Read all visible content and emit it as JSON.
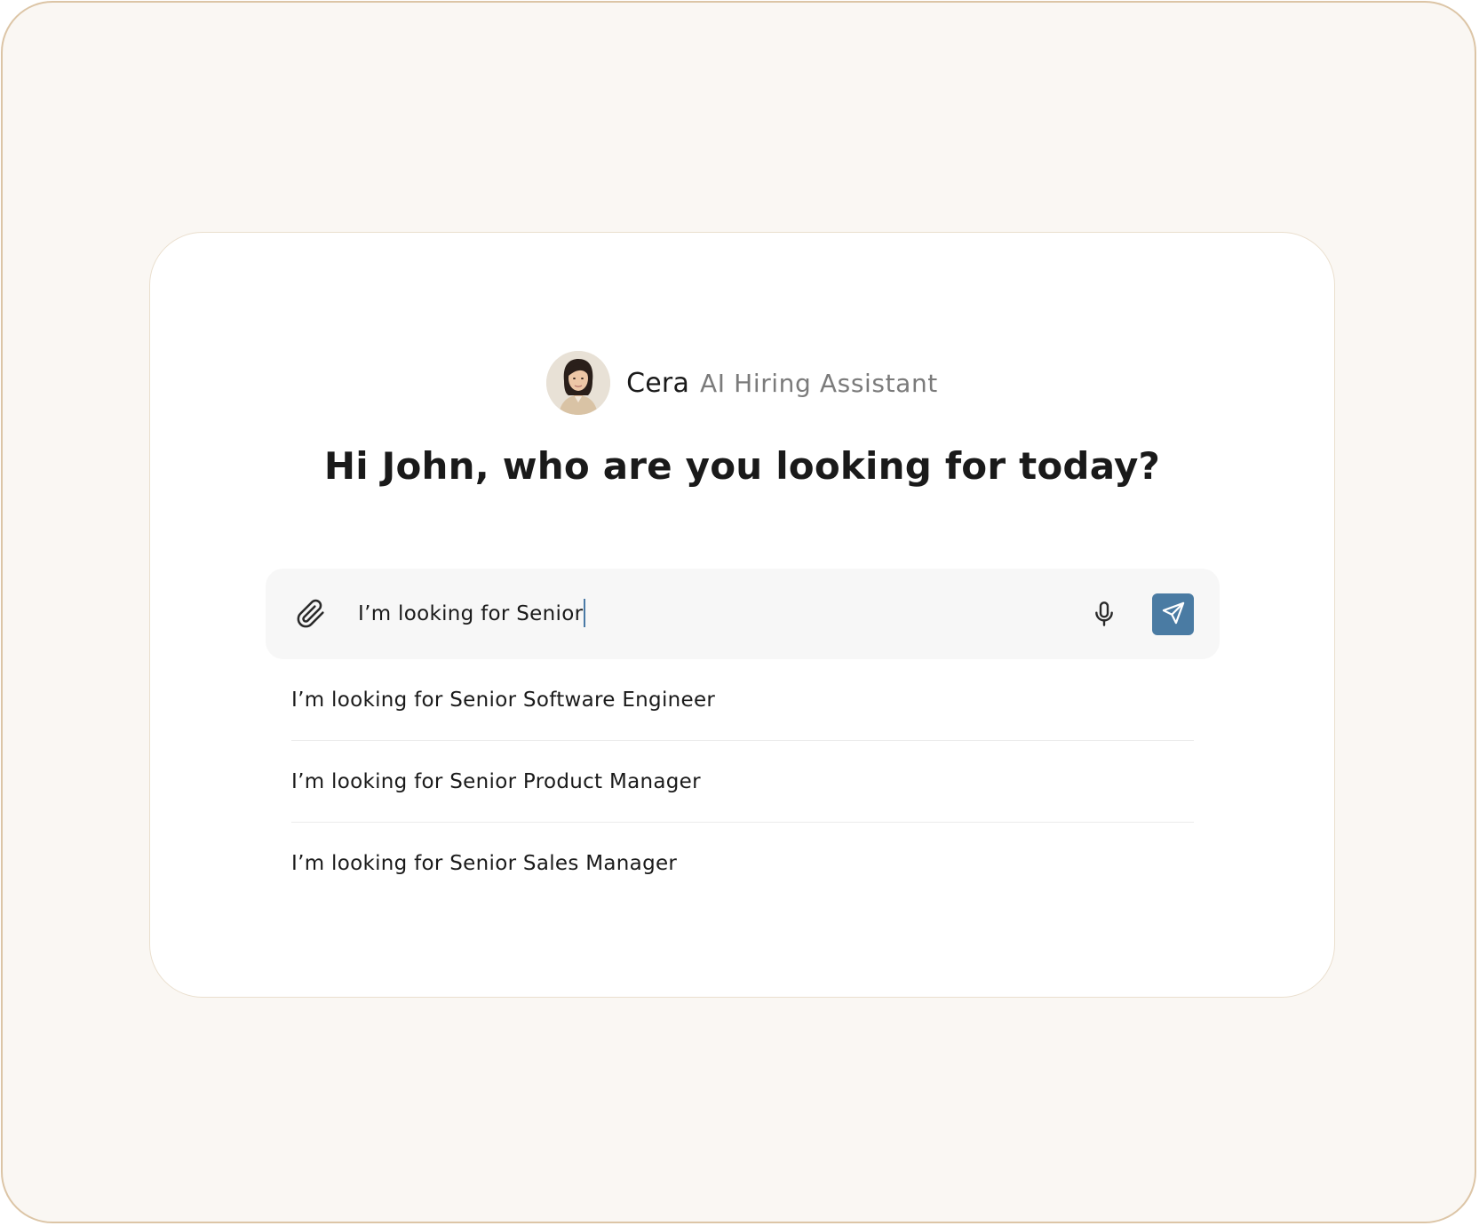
{
  "assistant": {
    "name": "Cera",
    "role": "AI Hiring Assistant"
  },
  "greeting": "Hi John, who are you looking for today?",
  "input": {
    "value": "I’m looking for Senior"
  },
  "suggestions": [
    "I’m looking for Senior Software Engineer",
    "I’m looking for Senior Product Manager",
    "I’m looking for Senior Sales Manager"
  ],
  "icons": {
    "attach": "paperclip-icon",
    "mic": "microphone-icon",
    "send": "send-icon"
  },
  "colors": {
    "page_background": "#faf7f3",
    "frame_border": "#dcc5a6",
    "card_background": "#ffffff",
    "input_background": "#f7f7f7",
    "send_button": "#4a7ba3",
    "text_primary": "#1a1a1a",
    "text_secondary": "#7b7b7b"
  }
}
